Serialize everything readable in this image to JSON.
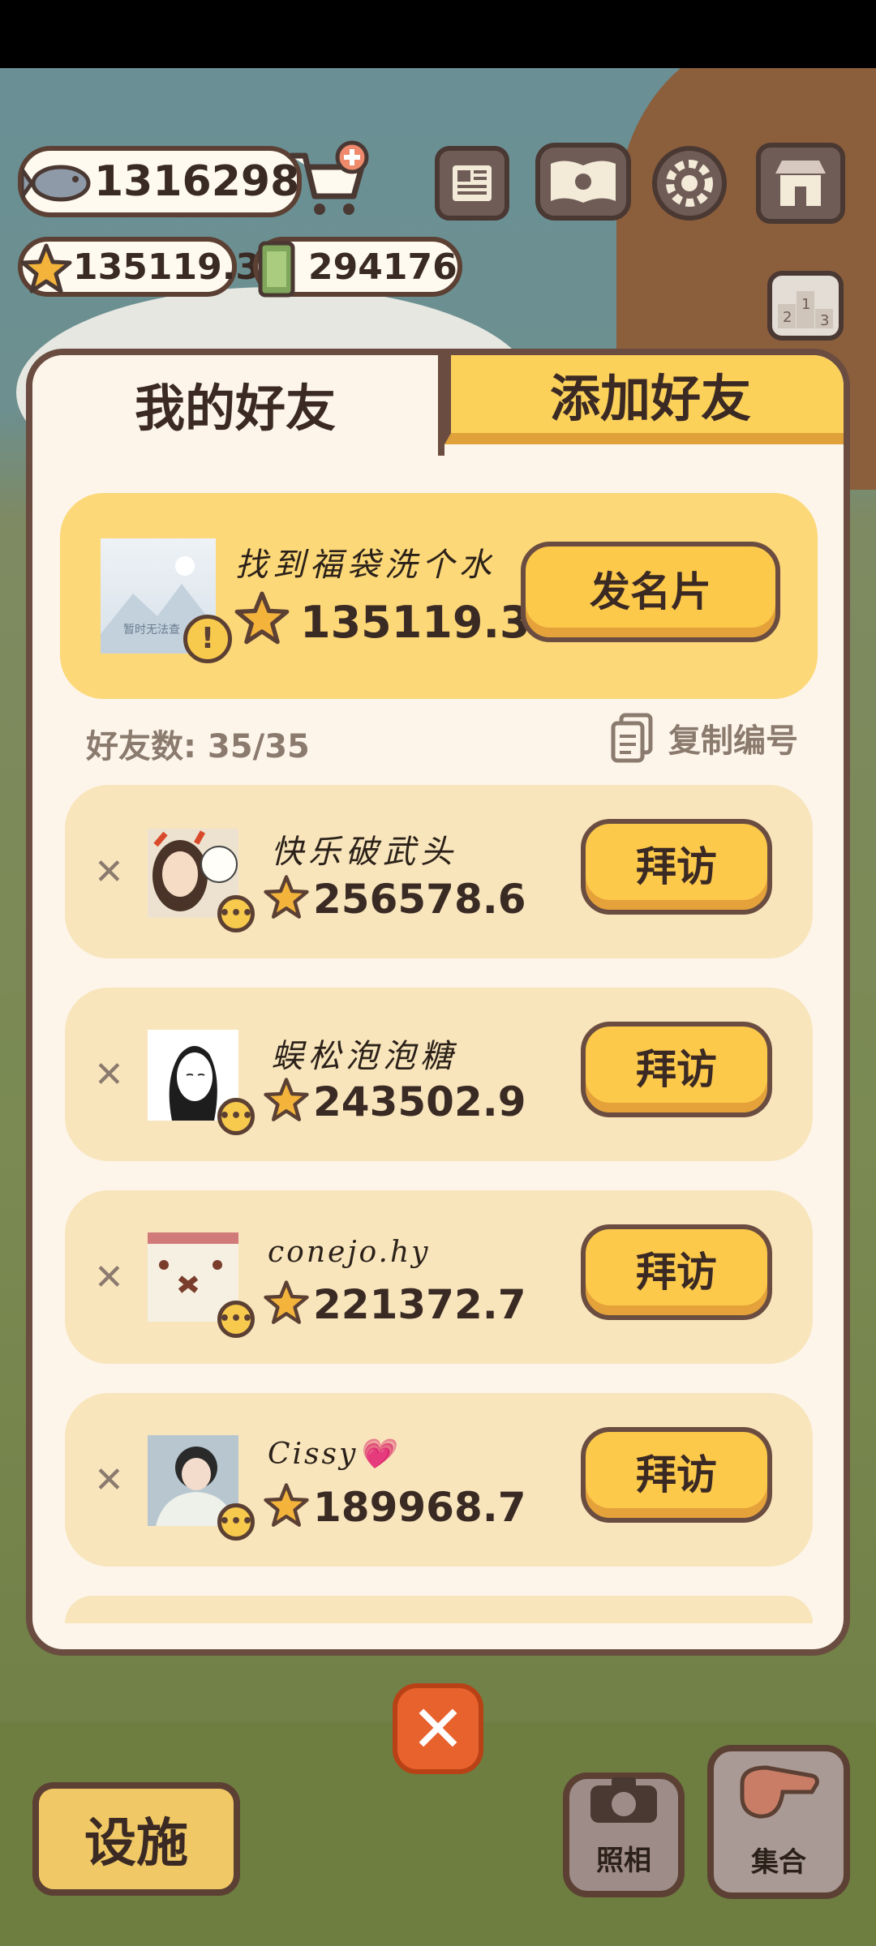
{
  "currency": {
    "fish": "1316298",
    "stars": "135119.3",
    "cash": "294176"
  },
  "tabs": {
    "my_friends": "我的好友",
    "add_friend": "添加好友"
  },
  "me": {
    "avatar_placeholder": "暂时无法查",
    "name": "找到福袋洗个水",
    "score": "135119.3",
    "button": "发名片"
  },
  "friend_count": {
    "label": "好友数: 35/35"
  },
  "copy_id": {
    "label": "复制编号"
  },
  "friends": [
    {
      "name": "快乐破武头",
      "score": "256578.6",
      "button": "拜访"
    },
    {
      "name": "蜈松泡泡糖",
      "score": "243502.9",
      "button": "拜访"
    },
    {
      "name": "conejo.hy",
      "score": "221372.7",
      "button": "拜访"
    },
    {
      "name": "Cissy💗",
      "score": "189968.7",
      "button": "拜访"
    }
  ],
  "bottom": {
    "facility": "设施",
    "photo": "照相",
    "gather": "集合"
  },
  "colors": {
    "accent_yellow": "#fcc94a",
    "panel_bg": "#fdf5ea",
    "border_brown": "#6a4d40",
    "close_orange": "#e8622e"
  }
}
